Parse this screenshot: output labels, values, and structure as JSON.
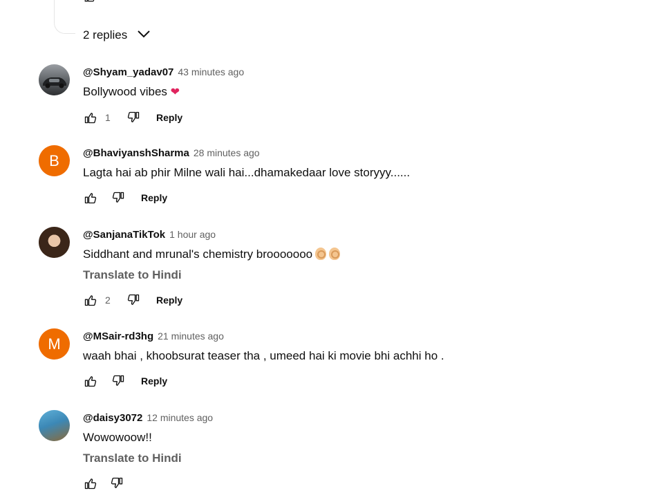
{
  "thread": {
    "replies_label": "2 replies"
  },
  "comments": [
    {
      "author": "@Shyam_yadav07",
      "time": "43 minutes ago",
      "text": "Bollywood vibes",
      "emoji": "❤",
      "likes": "1",
      "reply_label": "Reply",
      "avatar": "car-photo"
    },
    {
      "author": "@BhaviyanshSharma",
      "time": "28 minutes ago",
      "text": "Lagta hai ab phir Milne wali hai...dhamakedaar love storyyy......",
      "likes": "",
      "reply_label": "Reply",
      "avatar_letter": "B"
    },
    {
      "author": "@SanjanaTikTok",
      "time": "1 hour ago",
      "text": "Siddhant and mrunal's chemistry brooooooo",
      "translate": "Translate to Hindi",
      "likes": "2",
      "reply_label": "Reply",
      "avatar": "portrait-photo"
    },
    {
      "author": "@MSair-rd3hg",
      "time": "21 minutes ago",
      "text": "waah bhai , khoobsurat teaser tha , umeed hai ki movie bhi achhi ho .",
      "likes": "",
      "reply_label": "Reply",
      "avatar_letter": "M"
    },
    {
      "author": "@daisy3072",
      "time": "12 minutes ago",
      "text": "Wowowoow!!",
      "translate": "Translate to Hindi",
      "avatar": "portrait-photo"
    }
  ],
  "colors": {
    "avatar_letter_bg": "#ef6c00",
    "secondary_text": "#606060",
    "primary_text": "#0f0f0f"
  }
}
